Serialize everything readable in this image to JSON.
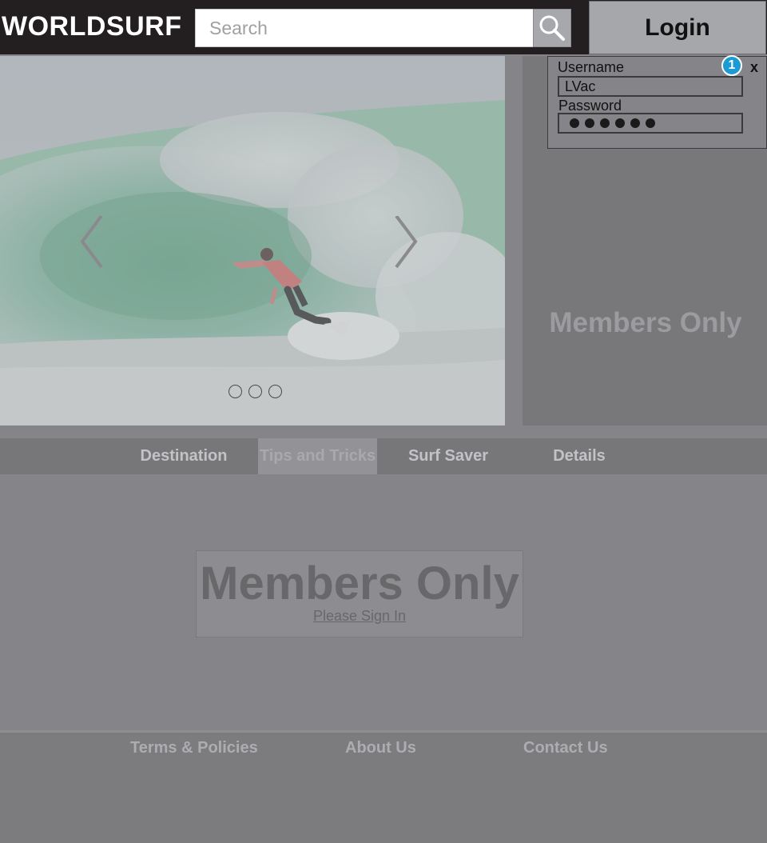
{
  "header": {
    "logo": "WORLDSURF",
    "search_placeholder": "Search",
    "search_icon": "search-icon",
    "login_label": "Login"
  },
  "hero": {
    "prev_icon": "chevron-left-icon",
    "next_icon": "chevron-right-icon",
    "slide_count": 3
  },
  "login_popover": {
    "badge": "1",
    "close": "x",
    "username_label": "Username",
    "username_value": "LVac",
    "password_label": "Password",
    "password_masked_length": 6
  },
  "side_panel": {
    "members_label": "Members Only"
  },
  "tabs": [
    {
      "label": "Destination",
      "active": false
    },
    {
      "label": "Tips and Tricks",
      "active": true
    },
    {
      "label": "Surf Saver",
      "active": false
    },
    {
      "label": "Details",
      "active": false
    }
  ],
  "members_box": {
    "title": "Members Only",
    "link": "Please Sign In"
  },
  "footer": {
    "links": [
      "Terms & Policies",
      "About Us",
      "Contact Us"
    ]
  },
  "colors": {
    "header_bg": "#231f20",
    "badge": "#1b9bd3",
    "overlay": "#858589"
  }
}
